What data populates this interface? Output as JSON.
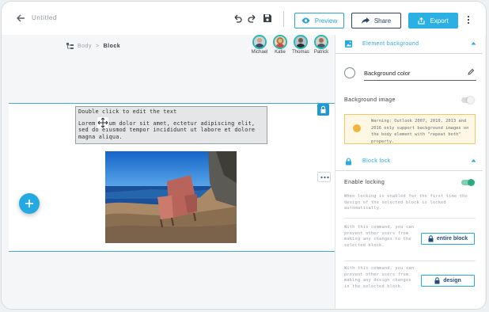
{
  "header": {
    "doc_title": "Untitled",
    "preview_label": "Preview",
    "share_label": "Share",
    "export_label": "Export"
  },
  "breadcrumb": {
    "root": "Body",
    "separator": ">",
    "current": "Block"
  },
  "collaborators": [
    {
      "name": "Michael",
      "color": "#d7a27a"
    },
    {
      "name": "Katie",
      "color": "#e2b48c"
    },
    {
      "name": "Thomas",
      "color": "#6f5b4d"
    },
    {
      "name": "Patrick",
      "color": "#a2705a"
    }
  ],
  "canvas": {
    "text_line1": "Double click to edit the text",
    "text_body": "Lorem ipsum dolor sit amet,  ectetur adipiscing elit, sed do eiusmod tempor incididunt ut labore et dolore magna aliqua."
  },
  "panel": {
    "element_background": {
      "title": "Element background",
      "bg_color_label": "Background color",
      "bg_image_label": "Background image",
      "bg_image_enabled": false,
      "warning": "Warning: Outlook 2007, 2010, 2013 and 2016 only support background images on the body element with \"repeat both\" property."
    },
    "block_lock": {
      "title": "Block lock",
      "enable_label": "Enable locking",
      "locking_enabled": true,
      "enable_desc": "When locking is enabled for the first time the design of the selected block is locked automatically.",
      "entire_desc": "With this command, you can prevent other users from making any changes to the selected block.",
      "entire_label": "entire block",
      "design_desc": "With this command, you can prevent other users from making any design changes in the selected block.",
      "design_label": "design"
    }
  },
  "colors": {
    "accent": "#25a9e2",
    "share": "#30416a",
    "selection": "#3fa9d6"
  }
}
